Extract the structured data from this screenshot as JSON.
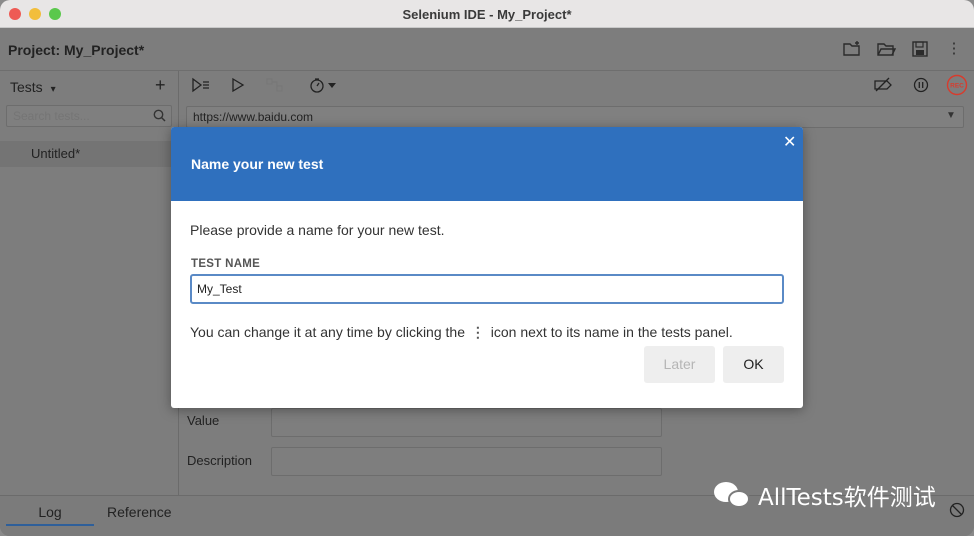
{
  "window": {
    "title": "Selenium IDE - My_Project*"
  },
  "project": {
    "label": "Project:  My_Project*"
  },
  "sidebar": {
    "header": "Tests",
    "header_caret": "▾",
    "add_icon": "+",
    "search_placeholder": "Search tests...",
    "tests": [
      {
        "name": "Untitled*"
      }
    ]
  },
  "toolbar": {
    "url": "https://www.baidu.com",
    "rec_label": "REC"
  },
  "fields": {
    "value_label": "Value",
    "description_label": "Description"
  },
  "bottom": {
    "tab_log": "Log",
    "tab_reference": "Reference"
  },
  "watermark": {
    "text": "AllTests软件测试"
  },
  "modal": {
    "title": "Name your new test",
    "close": "✕",
    "prompt": "Please provide a name for your new test.",
    "field_label": "TEST NAME",
    "field_value": "My_Test",
    "hint_before": "You can change it at any time by clicking the",
    "hint_icon": "⋮",
    "hint_after": "icon next to its name in the tests panel.",
    "later_label": "Later",
    "ok_label": "OK"
  },
  "colors": {
    "modal_header": "#2f70be",
    "rec": "#d83b2d",
    "tab_underline": "#2e5f9a"
  }
}
